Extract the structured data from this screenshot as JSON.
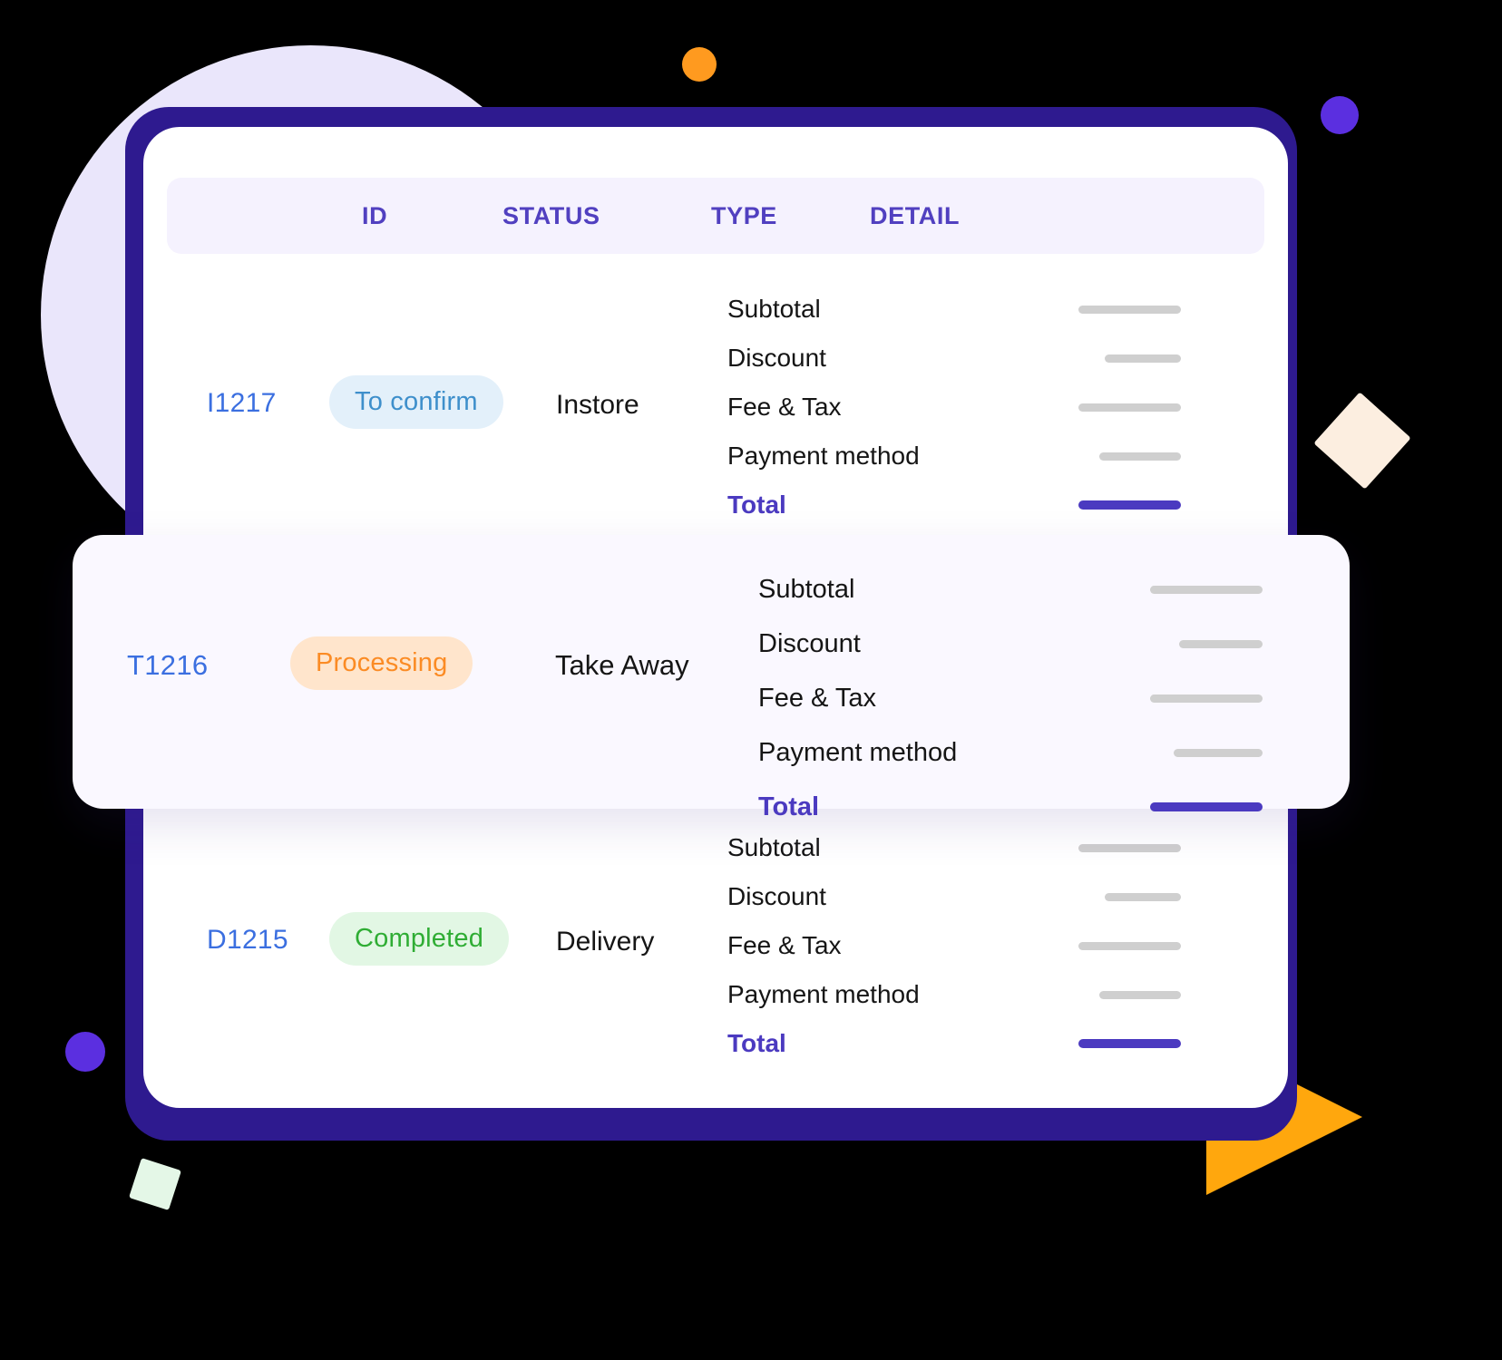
{
  "table": {
    "columns": [
      {
        "key": "id",
        "label": "ID"
      },
      {
        "key": "status",
        "label": "STATUS"
      },
      {
        "key": "type",
        "label": "TYPE"
      },
      {
        "key": "detail",
        "label": "DETAIL"
      }
    ],
    "detail_labels": {
      "subtotal": "Subtotal",
      "discount": "Discount",
      "fee_tax": "Fee & Tax",
      "payment_method": "Payment method",
      "total": "Total"
    },
    "rows": [
      {
        "id": "I1217",
        "status": "To confirm",
        "status_color": "#3E8FCB",
        "status_bg": "#E3F0FA",
        "type": "Instore",
        "highlighted": false
      },
      {
        "id": "T1216",
        "status": "Processing",
        "status_color": "#FB8B24",
        "status_bg": "#FFE5CC",
        "type": "Take Away",
        "highlighted": true
      },
      {
        "id": "D1215",
        "status": "Completed",
        "status_color": "#2FAD34",
        "status_bg": "#E2F7E4",
        "type": "Delivery",
        "highlighted": false
      }
    ]
  },
  "theme": {
    "background": "#000000",
    "frame": "#2E1A8F",
    "card": "#FFFFFF",
    "header_bg": "#F5F2FE",
    "header_text": "#5140C0",
    "id_text": "#3B6FE0",
    "total_text": "#4B3AC0",
    "placeholder_bar": "#CFCFCF",
    "accent_orange": "#FFA70D",
    "accent_purple": "#5B2FE0",
    "accent_lavender": "#EAE6FB",
    "accent_cream": "#FCEEE0",
    "accent_green": "#E4F7E7"
  },
  "decorations": [
    {
      "name": "large-lavender-circle",
      "shape": "circle"
    },
    {
      "name": "orange-dot",
      "shape": "circle"
    },
    {
      "name": "purple-dot-top-right",
      "shape": "circle"
    },
    {
      "name": "cream-diamond",
      "shape": "square"
    },
    {
      "name": "purple-dot-bottom-left",
      "shape": "circle"
    },
    {
      "name": "green-square",
      "shape": "square"
    },
    {
      "name": "orange-play-triangle",
      "shape": "triangle"
    }
  ]
}
